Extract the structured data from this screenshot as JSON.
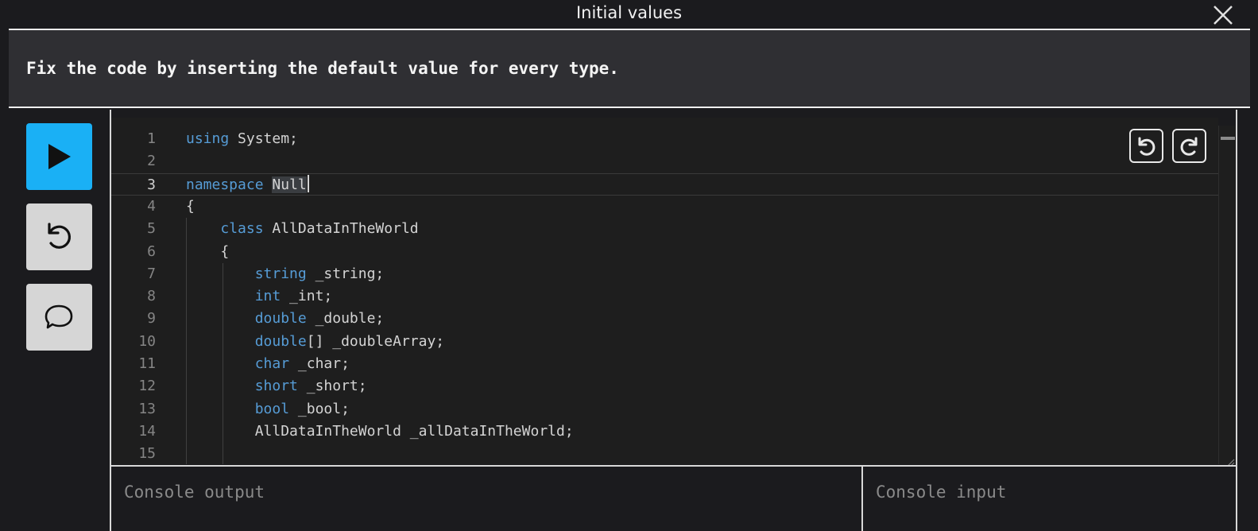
{
  "window": {
    "title": "Initial values",
    "close_icon": "close-icon"
  },
  "instructions": {
    "text": "Fix the code by inserting the default value for every type."
  },
  "sidebar": {
    "run_icon": "play-icon",
    "reset_icon": "reset-icon",
    "hint_icon": "speech-bubble-icon",
    "run_color": "#1ab0f5",
    "button_color": "#d6d6d6"
  },
  "editor": {
    "undo_icon": "undo-icon",
    "redo_icon": "redo-icon",
    "current_line": 3,
    "lines": [
      {
        "number": "1",
        "parts": [
          {
            "t": "using",
            "kw": true
          },
          {
            "t": " System;"
          }
        ]
      },
      {
        "number": "2",
        "parts": []
      },
      {
        "number": "3",
        "parts": [
          {
            "t": "namespace",
            "kw": true
          },
          {
            "t": " "
          },
          {
            "t": "Null",
            "sel": true
          }
        ]
      },
      {
        "number": "4",
        "parts": [
          {
            "t": "{"
          }
        ]
      },
      {
        "number": "5",
        "parts": [
          {
            "t": "    "
          },
          {
            "t": "class",
            "kw": true
          },
          {
            "t": " AllDataInTheWorld"
          }
        ]
      },
      {
        "number": "6",
        "parts": [
          {
            "t": "    {"
          }
        ]
      },
      {
        "number": "7",
        "parts": [
          {
            "t": "        "
          },
          {
            "t": "string",
            "kw": true
          },
          {
            "t": " _string;"
          }
        ]
      },
      {
        "number": "8",
        "parts": [
          {
            "t": "        "
          },
          {
            "t": "int",
            "kw": true
          },
          {
            "t": " _int;"
          }
        ]
      },
      {
        "number": "9",
        "parts": [
          {
            "t": "        "
          },
          {
            "t": "double",
            "kw": true
          },
          {
            "t": " _double;"
          }
        ]
      },
      {
        "number": "10",
        "parts": [
          {
            "t": "        "
          },
          {
            "t": "double",
            "kw": true
          },
          {
            "t": "[] _doubleArray;"
          }
        ]
      },
      {
        "number": "11",
        "parts": [
          {
            "t": "        "
          },
          {
            "t": "char",
            "kw": true
          },
          {
            "t": " _char;"
          }
        ]
      },
      {
        "number": "12",
        "parts": [
          {
            "t": "        "
          },
          {
            "t": "short",
            "kw": true
          },
          {
            "t": " _short;"
          }
        ]
      },
      {
        "number": "13",
        "parts": [
          {
            "t": "        "
          },
          {
            "t": "bool",
            "kw": true
          },
          {
            "t": " _bool;"
          }
        ]
      },
      {
        "number": "14",
        "parts": [
          {
            "t": "        AllDataInTheWorld _allDataInTheWorld;"
          }
        ]
      },
      {
        "number": "15",
        "parts": []
      }
    ]
  },
  "console": {
    "output_placeholder": "Console output",
    "input_placeholder": "Console input"
  }
}
